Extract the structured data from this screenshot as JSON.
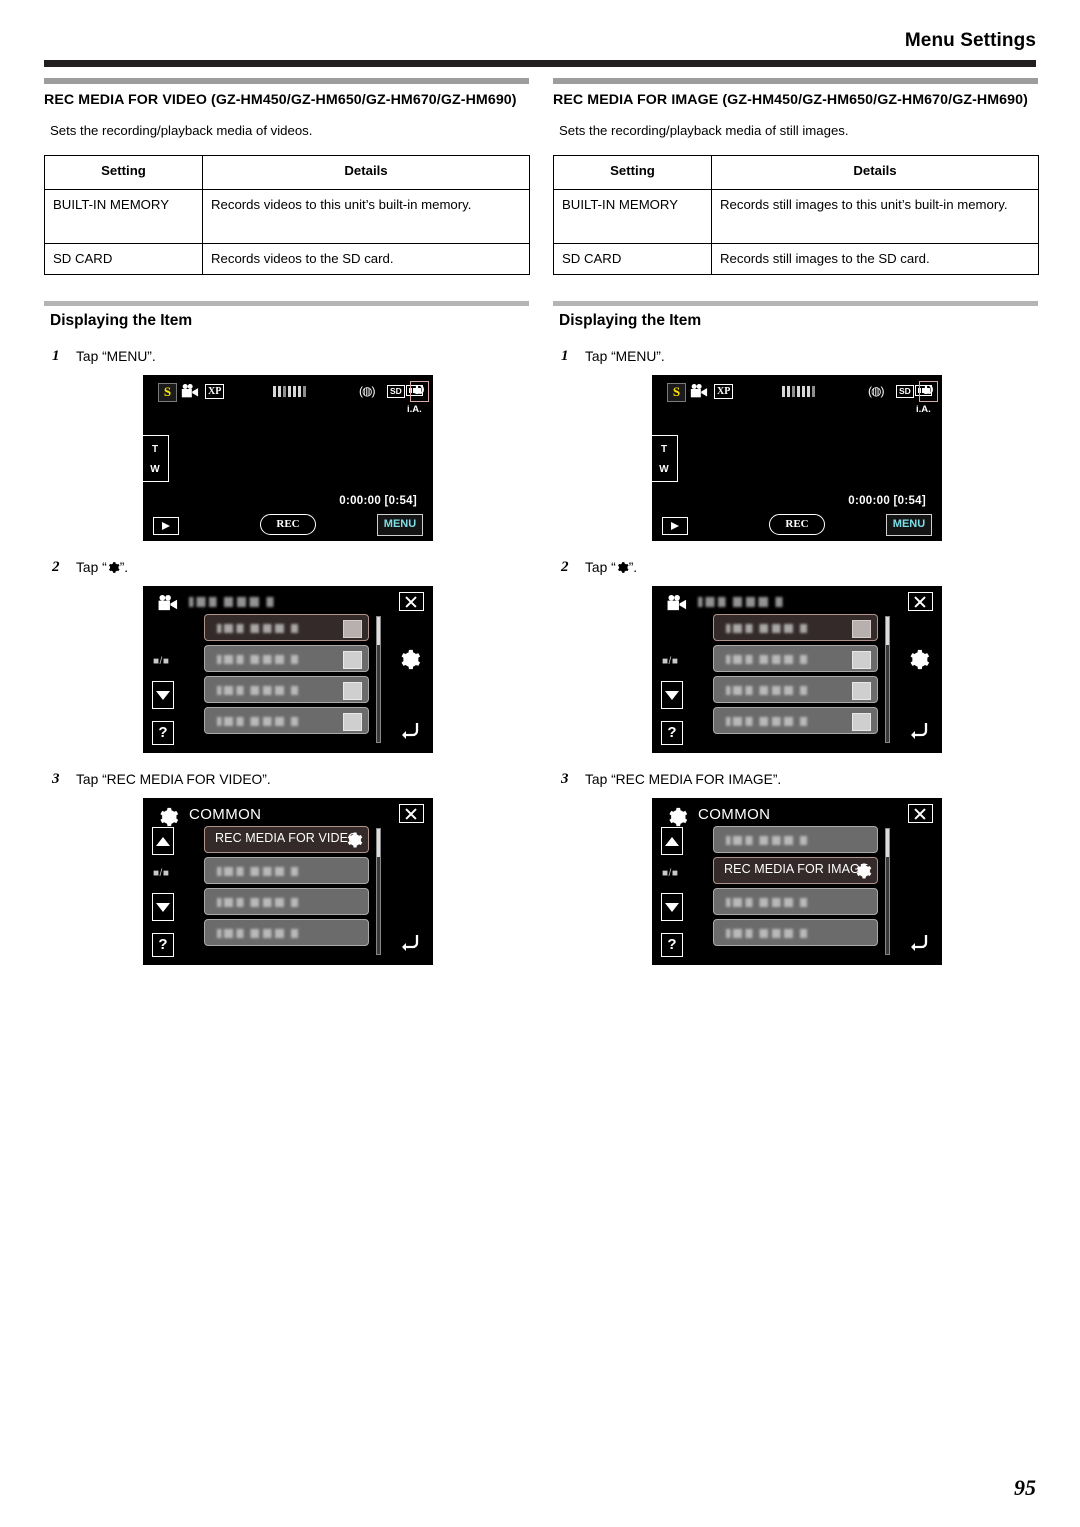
{
  "header": {
    "title": "Menu Settings"
  },
  "page_number": "95",
  "columns": [
    {
      "section_title": "REC MEDIA FOR VIDEO (GZ-HM450/GZ-HM650/GZ-HM670/GZ-HM690)",
      "section_desc": "Sets the recording/playback media of videos.",
      "table": {
        "headers": [
          "Setting",
          "Details"
        ],
        "rows": [
          [
            "BUILT-IN MEMORY",
            "Records videos to this unit’s built-in memory."
          ],
          [
            "SD CARD",
            "Records videos to the SD card."
          ]
        ]
      },
      "sub_title": "Displaying the Item",
      "steps": [
        {
          "num": "1",
          "text": "Tap “MENU”."
        },
        {
          "num": "2",
          "text_before": "Tap “",
          "icon": "gear-icon",
          "text_after": "”."
        },
        {
          "num": "3",
          "text": "Tap “REC MEDIA FOR VIDEO”."
        }
      ],
      "rec_screen": {
        "badge_s": "S",
        "quality": "XP",
        "sd": "SD",
        "digital": "D",
        "ia": "i.A.",
        "zoom_t": "T",
        "zoom_w": "W",
        "timecode": "0:00:00  [0:54]",
        "rec_label": "REC",
        "menu_label": "MENU"
      },
      "menu_screen": {
        "header_title": "",
        "page_indicator": "■/■",
        "help_label": "?",
        "rows": [
          {
            "label": "",
            "selected": true
          },
          {
            "label": "",
            "selected": false
          },
          {
            "label": "",
            "selected": false
          },
          {
            "label": "",
            "selected": false
          }
        ]
      },
      "common_screen": {
        "header_title": "COMMON",
        "page_indicator": "■/■",
        "help_label": "?",
        "rows": [
          {
            "label": "REC MEDIA FOR VIDEO",
            "selected": true
          },
          {
            "label": "",
            "selected": false
          },
          {
            "label": "",
            "selected": false
          },
          {
            "label": "",
            "selected": false
          }
        ]
      }
    },
    {
      "section_title": "REC MEDIA FOR IMAGE (GZ-HM450/GZ-HM650/GZ-HM670/GZ-HM690)",
      "section_desc": "Sets the recording/playback media of still images.",
      "table": {
        "headers": [
          "Setting",
          "Details"
        ],
        "rows": [
          [
            "BUILT-IN MEMORY",
            "Records still images to this unit’s built-in memory."
          ],
          [
            "SD CARD",
            "Records still images to the SD card."
          ]
        ]
      },
      "sub_title": "Displaying the Item",
      "steps": [
        {
          "num": "1",
          "text": "Tap “MENU”."
        },
        {
          "num": "2",
          "text_before": "Tap “",
          "icon": "gear-icon",
          "text_after": "”."
        },
        {
          "num": "3",
          "text": "Tap “REC MEDIA FOR IMAGE”."
        }
      ],
      "rec_screen": {
        "badge_s": "S",
        "quality": "XP",
        "sd": "SD",
        "digital": "D",
        "ia": "i.A.",
        "zoom_t": "T",
        "zoom_w": "W",
        "timecode": "0:00:00  [0:54]",
        "rec_label": "REC",
        "menu_label": "MENU"
      },
      "menu_screen": {
        "header_title": "",
        "page_indicator": "■/■",
        "help_label": "?",
        "rows": [
          {
            "label": "",
            "selected": true
          },
          {
            "label": "",
            "selected": false
          },
          {
            "label": "",
            "selected": false
          },
          {
            "label": "",
            "selected": false
          }
        ]
      },
      "common_screen": {
        "header_title": "COMMON",
        "page_indicator": "■/■",
        "help_label": "?",
        "rows": [
          {
            "label": "",
            "selected": false
          },
          {
            "label": "REC MEDIA FOR IMAGE",
            "selected": true
          },
          {
            "label": "",
            "selected": false
          },
          {
            "label": "",
            "selected": false
          }
        ]
      }
    }
  ]
}
